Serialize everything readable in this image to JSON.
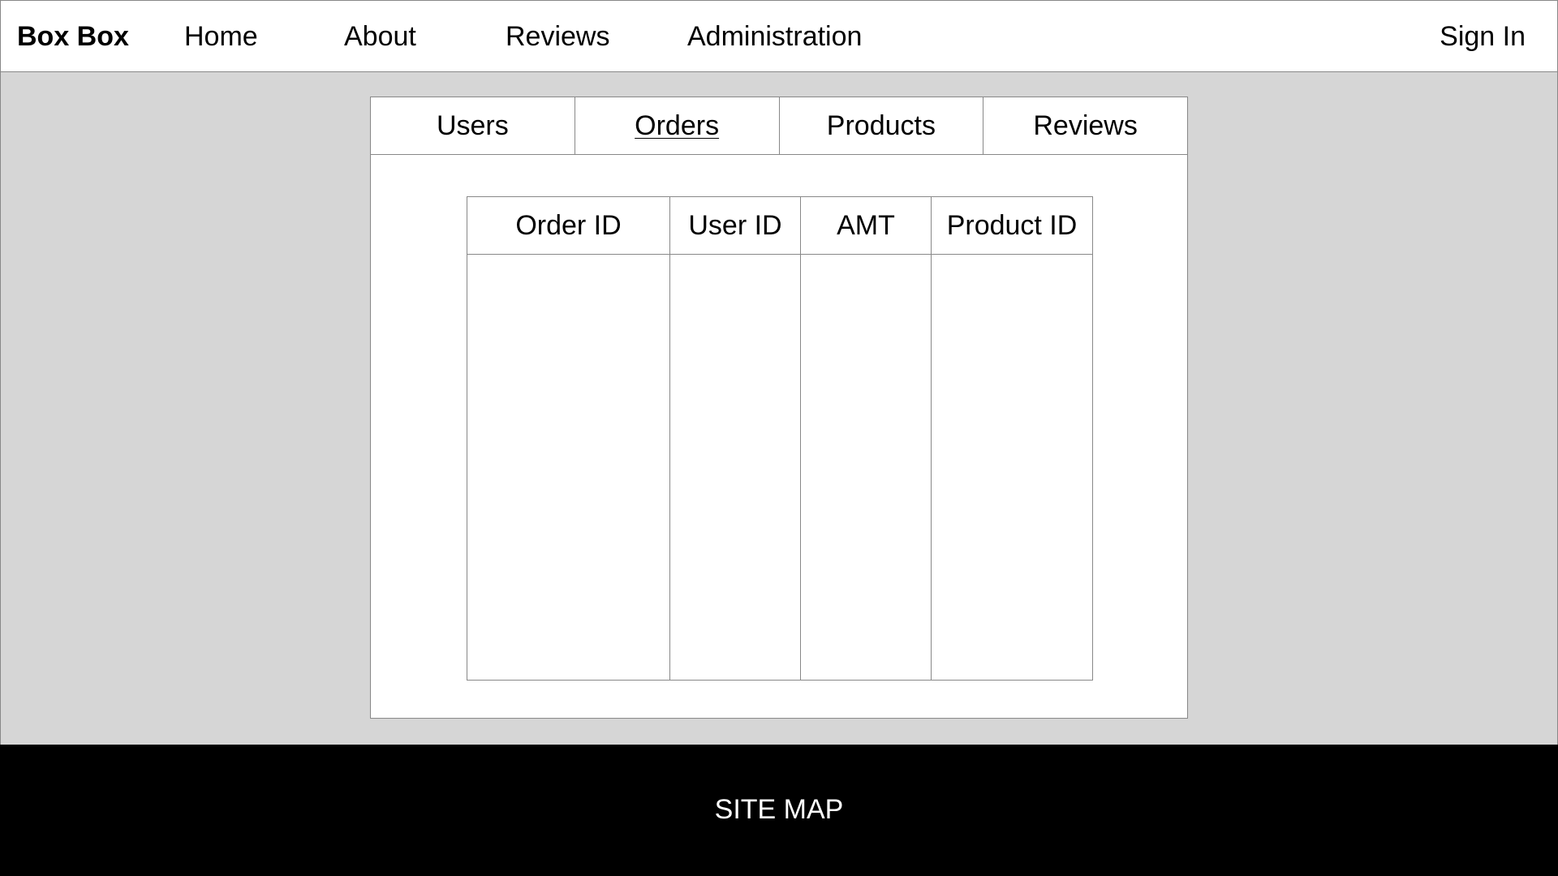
{
  "nav": {
    "brand": "Box Box",
    "items": [
      {
        "label": "Home"
      },
      {
        "label": "About"
      },
      {
        "label": "Reviews"
      },
      {
        "label": "Administration"
      }
    ],
    "sign_in": "Sign In"
  },
  "admin": {
    "tabs": [
      {
        "label": "Users"
      },
      {
        "label": "Orders",
        "active": true
      },
      {
        "label": "Products"
      },
      {
        "label": "Reviews"
      }
    ],
    "table": {
      "columns": [
        "Order ID",
        "User ID",
        "AMT",
        "Product ID"
      ],
      "rows": []
    }
  },
  "footer": {
    "link": "SITE MAP"
  },
  "colors": {
    "background": "#d6d6d6",
    "panel": "#ffffff",
    "footer": "#000000",
    "border": "#888888"
  }
}
